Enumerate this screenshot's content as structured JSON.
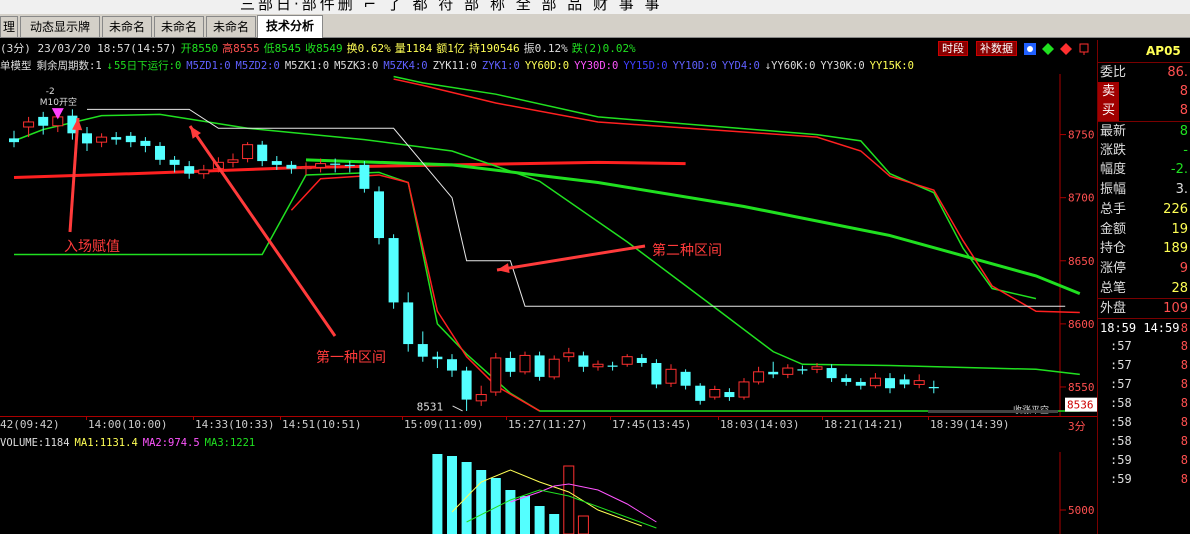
{
  "menubar": {
    "text": "三部日·部件删 ⌐ 了 都 符 部 称 全 部 品 财 事 事"
  },
  "tabs": [
    {
      "label": "理"
    },
    {
      "label": "动态显示牌"
    },
    {
      "label": "未命名"
    },
    {
      "label": "未命名"
    },
    {
      "label": "未命名"
    },
    {
      "label": "技术分析"
    }
  ],
  "info": {
    "period": "(3分) 23/03/20 18:57(14:57)",
    "open": "开8550",
    "high": "高8555",
    "low": "低8545",
    "close": "收8549",
    "turnover": "换0.62%",
    "volume": "量1184",
    "amount": "额1亿",
    "hold": "持190546",
    "amplitude": "振0.12%",
    "change": "跌(2)0.02%",
    "btn_timeshare": "时段",
    "btn_fill": "补数据"
  },
  "indicators": {
    "model": "单模型",
    "remaining": "剩余周期数:1",
    "arrow_down": "↓",
    "day55": "55日下运行:0",
    "items": [
      {
        "text": "M5ZD1:0",
        "color": "#6060ff"
      },
      {
        "text": "M5ZD2:0",
        "color": "#6060ff"
      },
      {
        "text": "M5ZK1:0",
        "color": "#dddddd"
      },
      {
        "text": "M5ZK3:0",
        "color": "#dddddd"
      },
      {
        "text": "M5ZK4:0",
        "color": "#6060ff"
      },
      {
        "text": "ZYK11:0",
        "color": "#dddddd"
      },
      {
        "text": "ZYK1:0",
        "color": "#6060ff"
      },
      {
        "text": "YY60D:0",
        "color": "#ffff55"
      },
      {
        "text": "YY30D:0",
        "color": "#ff55ff"
      },
      {
        "text": "YY15D:0",
        "color": "#4040ff"
      },
      {
        "text": "YY10D:0",
        "color": "#6060ff"
      },
      {
        "text": "YYD4:0",
        "color": "#6060ff"
      },
      {
        "text": "↓YY60K:0",
        "color": "#dddddd"
      },
      {
        "text": "YY30K:0",
        "color": "#dddddd"
      },
      {
        "text": "YY15K:0",
        "color": "#ffff55"
      }
    ]
  },
  "chart_data": {
    "type": "candlestick",
    "price_axis": {
      "labels": [
        "8750",
        "8700",
        "8650",
        "8600",
        "8550"
      ],
      "ylim": [
        8527,
        8798
      ]
    },
    "last_price_tag": "8536",
    "low_label": "8531",
    "marker_top": "-2",
    "marker_text": "M10开空",
    "marker_bottom_right": "收涨平空",
    "period_tag": "3分",
    "time_labels": [
      "42(09:42)",
      "14:00(10:00)",
      "14:33(10:33)",
      "14:51(10:51)",
      "15:09(11:09)",
      "15:27(11:27)",
      "17:45(13:45)",
      "18:03(14:03)",
      "18:21(14:21)",
      "18:39(14:39)"
    ],
    "candles": [
      {
        "o": 8747,
        "c": 8744,
        "h": 8753,
        "l": 8740
      },
      {
        "o": 8756,
        "c": 8760,
        "h": 8764,
        "l": 8748
      },
      {
        "o": 8764,
        "c": 8757,
        "h": 8768,
        "l": 8750
      },
      {
        "o": 8757,
        "c": 8764,
        "h": 8768,
        "l": 8752
      },
      {
        "o": 8765,
        "c": 8751,
        "h": 8770,
        "l": 8746
      },
      {
        "o": 8751,
        "c": 8743,
        "h": 8756,
        "l": 8737
      },
      {
        "o": 8744,
        "c": 8748,
        "h": 8751,
        "l": 8740
      },
      {
        "o": 8748,
        "c": 8746,
        "h": 8752,
        "l": 8742
      },
      {
        "o": 8749,
        "c": 8744,
        "h": 8752,
        "l": 8740
      },
      {
        "o": 8745,
        "c": 8741,
        "h": 8748,
        "l": 8736
      },
      {
        "o": 8741,
        "c": 8730,
        "h": 8744,
        "l": 8726
      },
      {
        "o": 8730,
        "c": 8726,
        "h": 8733,
        "l": 8720
      },
      {
        "o": 8725,
        "c": 8719,
        "h": 8729,
        "l": 8715
      },
      {
        "o": 8719,
        "c": 8722,
        "h": 8726,
        "l": 8715
      },
      {
        "o": 8723,
        "c": 8728,
        "h": 8732,
        "l": 8720
      },
      {
        "o": 8728,
        "c": 8730,
        "h": 8735,
        "l": 8724
      },
      {
        "o": 8731,
        "c": 8742,
        "h": 8744,
        "l": 8728
      },
      {
        "o": 8742,
        "c": 8729,
        "h": 8745,
        "l": 8725
      },
      {
        "o": 8729,
        "c": 8726,
        "h": 8733,
        "l": 8722
      },
      {
        "o": 8726,
        "c": 8723,
        "h": 8729,
        "l": 8719
      },
      {
        "o": 8723,
        "c": 8724,
        "h": 8728,
        "l": 8718
      },
      {
        "o": 8724,
        "c": 8727,
        "h": 8731,
        "l": 8720
      },
      {
        "o": 8727,
        "c": 8726,
        "h": 8731,
        "l": 8720
      },
      {
        "o": 8726,
        "c": 8725,
        "h": 8729,
        "l": 8720
      },
      {
        "o": 8726,
        "c": 8707,
        "h": 8729,
        "l": 8704
      },
      {
        "o": 8705,
        "c": 8668,
        "h": 8709,
        "l": 8663
      },
      {
        "o": 8668,
        "c": 8617,
        "h": 8671,
        "l": 8612
      },
      {
        "o": 8617,
        "c": 8584,
        "h": 8625,
        "l": 8578
      },
      {
        "o": 8584,
        "c": 8574,
        "h": 8594,
        "l": 8570
      },
      {
        "o": 8574,
        "c": 8572,
        "h": 8578,
        "l": 8565
      },
      {
        "o": 8572,
        "c": 8563,
        "h": 8576,
        "l": 8558
      },
      {
        "o": 8563,
        "c": 8540,
        "h": 8566,
        "l": 8531
      },
      {
        "o": 8539,
        "c": 8544,
        "h": 8551,
        "l": 8535
      },
      {
        "o": 8546,
        "c": 8573,
        "h": 8577,
        "l": 8543
      },
      {
        "o": 8573,
        "c": 8562,
        "h": 8578,
        "l": 8558
      },
      {
        "o": 8562,
        "c": 8575,
        "h": 8578,
        "l": 8560
      },
      {
        "o": 8575,
        "c": 8558,
        "h": 8578,
        "l": 8555
      },
      {
        "o": 8558,
        "c": 8572,
        "h": 8575,
        "l": 8556
      },
      {
        "o": 8574,
        "c": 8577,
        "h": 8581,
        "l": 8570
      },
      {
        "o": 8575,
        "c": 8566,
        "h": 8578,
        "l": 8562
      },
      {
        "o": 8566,
        "c": 8568,
        "h": 8571,
        "l": 8563
      },
      {
        "o": 8567,
        "c": 8566,
        "h": 8570,
        "l": 8563
      },
      {
        "o": 8568,
        "c": 8574,
        "h": 8576,
        "l": 8566
      },
      {
        "o": 8573,
        "c": 8569,
        "h": 8576,
        "l": 8566
      },
      {
        "o": 8569,
        "c": 8552,
        "h": 8572,
        "l": 8549
      },
      {
        "o": 8553,
        "c": 8564,
        "h": 8568,
        "l": 8550
      },
      {
        "o": 8562,
        "c": 8551,
        "h": 8564,
        "l": 8548
      },
      {
        "o": 8551,
        "c": 8539,
        "h": 8553,
        "l": 8536
      },
      {
        "o": 8542,
        "c": 8548,
        "h": 8551,
        "l": 8540
      },
      {
        "o": 8546,
        "c": 8542,
        "h": 8549,
        "l": 8539
      },
      {
        "o": 8542,
        "c": 8554,
        "h": 8557,
        "l": 8540
      },
      {
        "o": 8554,
        "c": 8562,
        "h": 8566,
        "l": 8552
      },
      {
        "o": 8562,
        "c": 8560,
        "h": 8570,
        "l": 8557
      },
      {
        "o": 8560,
        "c": 8565,
        "h": 8568,
        "l": 8557
      },
      {
        "o": 8564,
        "c": 8563,
        "h": 8567,
        "l": 8560
      },
      {
        "o": 8564,
        "c": 8566,
        "h": 8569,
        "l": 8561
      },
      {
        "o": 8565,
        "c": 8557,
        "h": 8568,
        "l": 8554
      },
      {
        "o": 8557,
        "c": 8554,
        "h": 8560,
        "l": 8551
      },
      {
        "o": 8554,
        "c": 8551,
        "h": 8557,
        "l": 8548
      },
      {
        "o": 8551,
        "c": 8557,
        "h": 8561,
        "l": 8549
      },
      {
        "o": 8557,
        "c": 8549,
        "h": 8561,
        "l": 8545
      },
      {
        "o": 8556,
        "c": 8552,
        "h": 8560,
        "l": 8549
      },
      {
        "o": 8552,
        "c": 8555,
        "h": 8560,
        "l": 8549
      },
      {
        "o": 8550,
        "c": 8549,
        "h": 8555,
        "l": 8545
      }
    ],
    "lines": [
      {
        "name": "thick-red",
        "color": "#ff2020",
        "width": 3,
        "points": [
          [
            0,
            8716
          ],
          [
            8,
            8719
          ],
          [
            20,
            8724
          ],
          [
            30,
            8726
          ],
          [
            40,
            8728
          ],
          [
            46,
            8727
          ]
        ]
      },
      {
        "name": "thick-green",
        "color": "#20e020",
        "width": 3,
        "points": [
          [
            20,
            8730
          ],
          [
            30,
            8726
          ],
          [
            40,
            8712
          ],
          [
            50,
            8693
          ],
          [
            60,
            8670
          ],
          [
            70,
            8638
          ],
          [
            73,
            8624
          ]
        ]
      },
      {
        "name": "green-upper",
        "color": "#20e020",
        "width": 1.5,
        "points": [
          [
            0,
            8745
          ],
          [
            2,
            8754
          ],
          [
            6,
            8765
          ],
          [
            10,
            8766
          ],
          [
            16,
            8755
          ],
          [
            24,
            8746
          ],
          [
            30,
            8737
          ],
          [
            36,
            8713
          ],
          [
            42,
            8665
          ],
          [
            48,
            8613
          ],
          [
            52,
            8578
          ],
          [
            54,
            8568
          ],
          [
            60,
            8567
          ],
          [
            70,
            8564
          ],
          [
            73,
            8560
          ]
        ]
      },
      {
        "name": "green-lower",
        "color": "#20e020",
        "width": 1.5,
        "points": [
          [
            0,
            8655
          ],
          [
            17,
            8655
          ],
          [
            20,
            8718
          ],
          [
            25,
            8720
          ],
          [
            27,
            8712
          ],
          [
            29,
            8600
          ],
          [
            31,
            8576
          ],
          [
            34,
            8545
          ],
          [
            36,
            8531
          ],
          [
            73,
            8531
          ]
        ]
      },
      {
        "name": "green-top",
        "color": "#20e020",
        "width": 1.5,
        "points": [
          [
            26,
            8796
          ],
          [
            28,
            8791
          ],
          [
            33,
            8782
          ],
          [
            40,
            8764
          ],
          [
            55,
            8750
          ],
          [
            58,
            8745
          ],
          [
            60,
            8719
          ],
          [
            63,
            8704
          ],
          [
            65,
            8660
          ],
          [
            67,
            8628
          ],
          [
            70,
            8620
          ]
        ]
      },
      {
        "name": "red-top",
        "color": "#ff2020",
        "width": 1.5,
        "points": [
          [
            26,
            8794
          ],
          [
            28,
            8789
          ],
          [
            33,
            8775
          ],
          [
            40,
            8760
          ],
          [
            55,
            8748
          ],
          [
            58,
            8737
          ],
          [
            60,
            8717
          ],
          [
            63,
            8706
          ],
          [
            65,
            8666
          ],
          [
            67,
            8630
          ],
          [
            70,
            8610
          ],
          [
            73,
            8609
          ]
        ]
      },
      {
        "name": "red-lower",
        "color": "#ff2020",
        "width": 1.5,
        "points": [
          [
            19,
            8690
          ],
          [
            21,
            8715
          ],
          [
            25,
            8718
          ],
          [
            27,
            8712
          ],
          [
            29,
            8610
          ],
          [
            31,
            8574
          ],
          [
            33,
            8551
          ],
          [
            36,
            8531
          ]
        ]
      },
      {
        "name": "white-line",
        "color": "#e8e8e8",
        "width": 1,
        "points": [
          [
            5,
            8770
          ],
          [
            12,
            8770
          ],
          [
            14,
            8755
          ],
          [
            26,
            8755
          ],
          [
            30,
            8700
          ],
          [
            31,
            8650
          ],
          [
            34,
            8650
          ],
          [
            35,
            8614
          ],
          [
            72,
            8614
          ]
        ]
      }
    ],
    "volume": {
      "labels": {
        "volume": "VOLUME:1184",
        "ma1": "MA1:1131.4",
        "ma2": "MA2:974.5",
        "ma3": "MA3:1221"
      },
      "axis_label": "5000",
      "bars": [
        {
          "i": 29,
          "h": 80,
          "up": false
        },
        {
          "i": 30,
          "h": 78,
          "up": false
        },
        {
          "i": 31,
          "h": 72,
          "up": false
        },
        {
          "i": 32,
          "h": 64,
          "up": false
        },
        {
          "i": 33,
          "h": 56,
          "up": false
        },
        {
          "i": 34,
          "h": 44,
          "up": false
        },
        {
          "i": 35,
          "h": 38,
          "up": false
        },
        {
          "i": 36,
          "h": 28,
          "up": false
        },
        {
          "i": 37,
          "h": 20,
          "up": false
        },
        {
          "i": 38,
          "h": 68,
          "up": true
        },
        {
          "i": 39,
          "h": 18,
          "up": true
        }
      ]
    }
  },
  "annotations": {
    "entry": "入场赋值",
    "zone1": "第一种区间",
    "zone2": "第二种区间"
  },
  "right_panel": {
    "code": "AP05",
    "code_num": "3",
    "rows": [
      {
        "label": "委比",
        "value": "86.",
        "color": "#ff5050"
      },
      {
        "label": "卖",
        "value": "8",
        "color": "#ff5050",
        "box": true
      },
      {
        "label": "买",
        "value": "8",
        "color": "#ff5050",
        "box": true
      },
      {
        "label": "最新",
        "value": "8",
        "color": "#20e020"
      },
      {
        "label": "涨跌",
        "value": "-",
        "color": "#20e020"
      },
      {
        "label": "幅度",
        "value": "-2.",
        "color": "#20e020"
      },
      {
        "label": "振幅",
        "value": "3.",
        "color": "#dddddd"
      },
      {
        "label": "总手",
        "value": "226",
        "color": "#ffff55"
      },
      {
        "label": "金额",
        "value": "19",
        "color": "#ffff55"
      },
      {
        "label": "持仓",
        "value": "189",
        "color": "#ffff55"
      },
      {
        "label": "涨停",
        "value": "9",
        "color": "#ff5050"
      },
      {
        "label": "总笔",
        "value": "28",
        "color": "#ffff55"
      },
      {
        "label": "外盘",
        "value": "109",
        "color": "#ff5050"
      }
    ],
    "tick_header": "18:59 14:59",
    "tick_header_val": "8",
    "ticks": [
      ":57",
      ":57",
      ":57",
      ":58",
      ":58",
      ":58",
      ":59",
      ":59"
    ],
    "tick_vals": [
      "8",
      "8",
      "8",
      "8",
      "8",
      "8",
      "8",
      "8"
    ]
  }
}
